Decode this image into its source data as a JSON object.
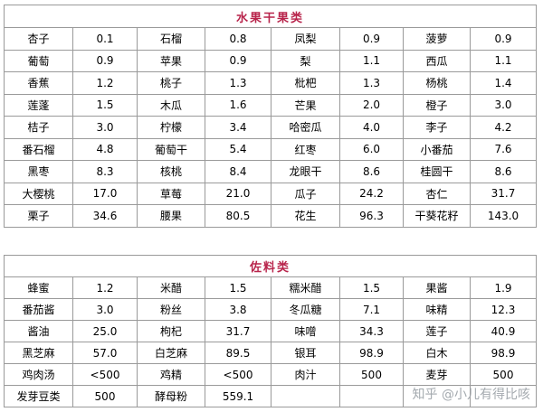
{
  "fruit_table": {
    "title": "水果干果类",
    "rows": [
      [
        [
          "杏子",
          "0.1"
        ],
        [
          "石榴",
          "0.8"
        ],
        [
          "凤梨",
          "0.9"
        ],
        [
          "菠萝",
          "0.9"
        ]
      ],
      [
        [
          "葡萄",
          "0.9"
        ],
        [
          "苹果",
          "0.9"
        ],
        [
          "梨",
          "1.1"
        ],
        [
          "西瓜",
          "1.1"
        ]
      ],
      [
        [
          "香蕉",
          "1.2"
        ],
        [
          "桃子",
          "1.3"
        ],
        [
          "枇杷",
          "1.3"
        ],
        [
          "杨桃",
          "1.4"
        ]
      ],
      [
        [
          "莲蓬",
          "1.5"
        ],
        [
          "木瓜",
          "1.6"
        ],
        [
          "芒果",
          "2.0"
        ],
        [
          "橙子",
          "3.0"
        ]
      ],
      [
        [
          "桔子",
          "3.0"
        ],
        [
          "柠檬",
          "3.4"
        ],
        [
          "哈密瓜",
          "4.0"
        ],
        [
          "李子",
          "4.2"
        ]
      ],
      [
        [
          "番石榴",
          "4.8"
        ],
        [
          "葡萄干",
          "5.4"
        ],
        [
          "红枣",
          "6.0"
        ],
        [
          "小番茄",
          "7.6"
        ]
      ],
      [
        [
          "黑枣",
          "8.3"
        ],
        [
          "核桃",
          "8.4"
        ],
        [
          "龙眼干",
          "8.6"
        ],
        [
          "桂圆干",
          "8.6"
        ]
      ],
      [
        [
          "大樱桃",
          "17.0"
        ],
        [
          "草莓",
          "21.0"
        ],
        [
          "瓜子",
          "24.2"
        ],
        [
          "杏仁",
          "31.7"
        ]
      ],
      [
        [
          "栗子",
          "34.6"
        ],
        [
          "腰果",
          "80.5"
        ],
        [
          "花生",
          "96.3"
        ],
        [
          "干葵花籽",
          "143.0"
        ]
      ]
    ]
  },
  "seasoning_table": {
    "title": "佐料类",
    "rows": [
      [
        [
          "蜂蜜",
          "1.2"
        ],
        [
          "米醋",
          "1.5"
        ],
        [
          "糯米醋",
          "1.5"
        ],
        [
          "果酱",
          "1.9"
        ]
      ],
      [
        [
          "番茄酱",
          "3.0"
        ],
        [
          "粉丝",
          "3.8"
        ],
        [
          "冬瓜糖",
          "7.1"
        ],
        [
          "味精",
          "12.3"
        ]
      ],
      [
        [
          "酱油",
          "25.0"
        ],
        [
          "枸杞",
          "31.7"
        ],
        [
          "味噌",
          "34.3"
        ],
        [
          "莲子",
          "40.9"
        ]
      ],
      [
        [
          "黑芝麻",
          "57.0"
        ],
        [
          "白芝麻",
          "89.5"
        ],
        [
          "银耳",
          "98.9"
        ],
        [
          "白木",
          "98.9"
        ]
      ],
      [
        [
          "鸡肉汤",
          "<500"
        ],
        [
          "鸡精",
          "<500"
        ],
        [
          "肉汁",
          "500"
        ],
        [
          "麦芽",
          "500"
        ]
      ],
      [
        [
          "发芽豆类",
          "500"
        ],
        [
          "酵母粉",
          "559.1"
        ],
        [
          "",
          ""
        ],
        [
          "",
          ""
        ]
      ]
    ]
  },
  "watermark": "知乎 @小儿有得比咳"
}
